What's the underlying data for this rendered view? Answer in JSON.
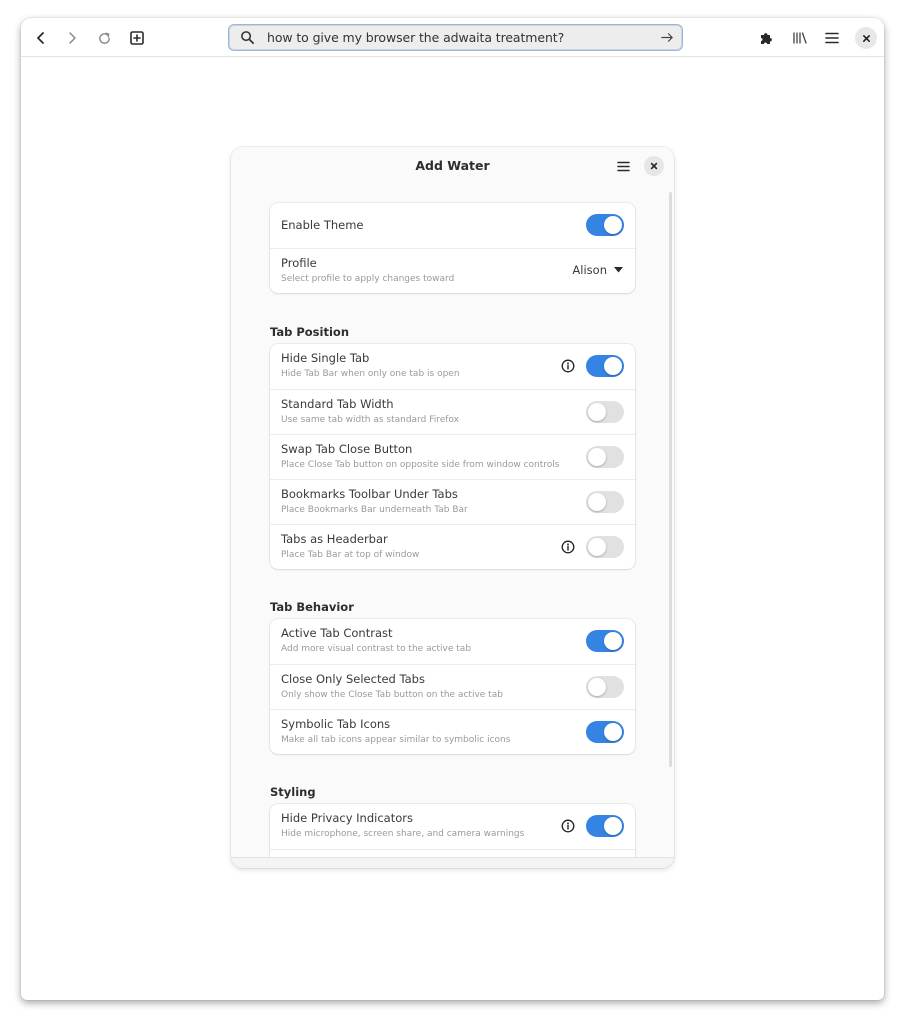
{
  "browser": {
    "url_text": "how to give my browser the adwaita treatment?",
    "toolbar_icons": {
      "back": "chevron-left-icon",
      "forward": "chevron-right-icon",
      "reload": "reload-icon",
      "new_tab": "new-tab-icon",
      "search": "search-icon",
      "go": "arrow-right-icon",
      "extensions": "puzzle-icon",
      "library": "library-icon",
      "menu": "hamburger-menu-icon",
      "close": "close-icon"
    }
  },
  "dialog": {
    "title": "Add Water",
    "general": {
      "enable_theme": {
        "title": "Enable Theme",
        "on": true
      },
      "profile": {
        "title": "Profile",
        "subtitle": "Select profile to apply changes toward",
        "value": "Alison"
      }
    },
    "sections": [
      {
        "heading": "Tab Position",
        "rows": [
          {
            "title": "Hide Single Tab",
            "subtitle": "Hide Tab Bar when only one tab is open",
            "info": true,
            "on": true
          },
          {
            "title": "Standard Tab Width",
            "subtitle": "Use same tab width as standard Firefox",
            "info": false,
            "on": false
          },
          {
            "title": "Swap Tab Close Button",
            "subtitle": "Place Close Tab button on opposite side from window controls",
            "info": false,
            "on": false
          },
          {
            "title": "Bookmarks Toolbar Under Tabs",
            "subtitle": "Place Bookmarks Bar underneath Tab Bar",
            "info": false,
            "on": false
          },
          {
            "title": "Tabs as Headerbar",
            "subtitle": "Place Tab Bar at top of window",
            "info": true,
            "on": false
          }
        ]
      },
      {
        "heading": "Tab Behavior",
        "rows": [
          {
            "title": "Active Tab Contrast",
            "subtitle": "Add more visual contrast to the active tab",
            "info": false,
            "on": true
          },
          {
            "title": "Close Only Selected Tabs",
            "subtitle": "Only show the Close Tab button on the active tab",
            "info": false,
            "on": false
          },
          {
            "title": "Symbolic Tab Icons",
            "subtitle": "Make all tab icons appear similar to symbolic icons",
            "info": false,
            "on": true
          }
        ]
      },
      {
        "heading": "Styling",
        "rows": [
          {
            "title": "Hide Privacy Indicators",
            "subtitle": "Hide microphone, screen share, and camera warnings",
            "info": true,
            "on": true
          }
        ]
      }
    ],
    "colors": {
      "accent": "#3584e4",
      "switch_off": "#e1e1e1"
    }
  }
}
